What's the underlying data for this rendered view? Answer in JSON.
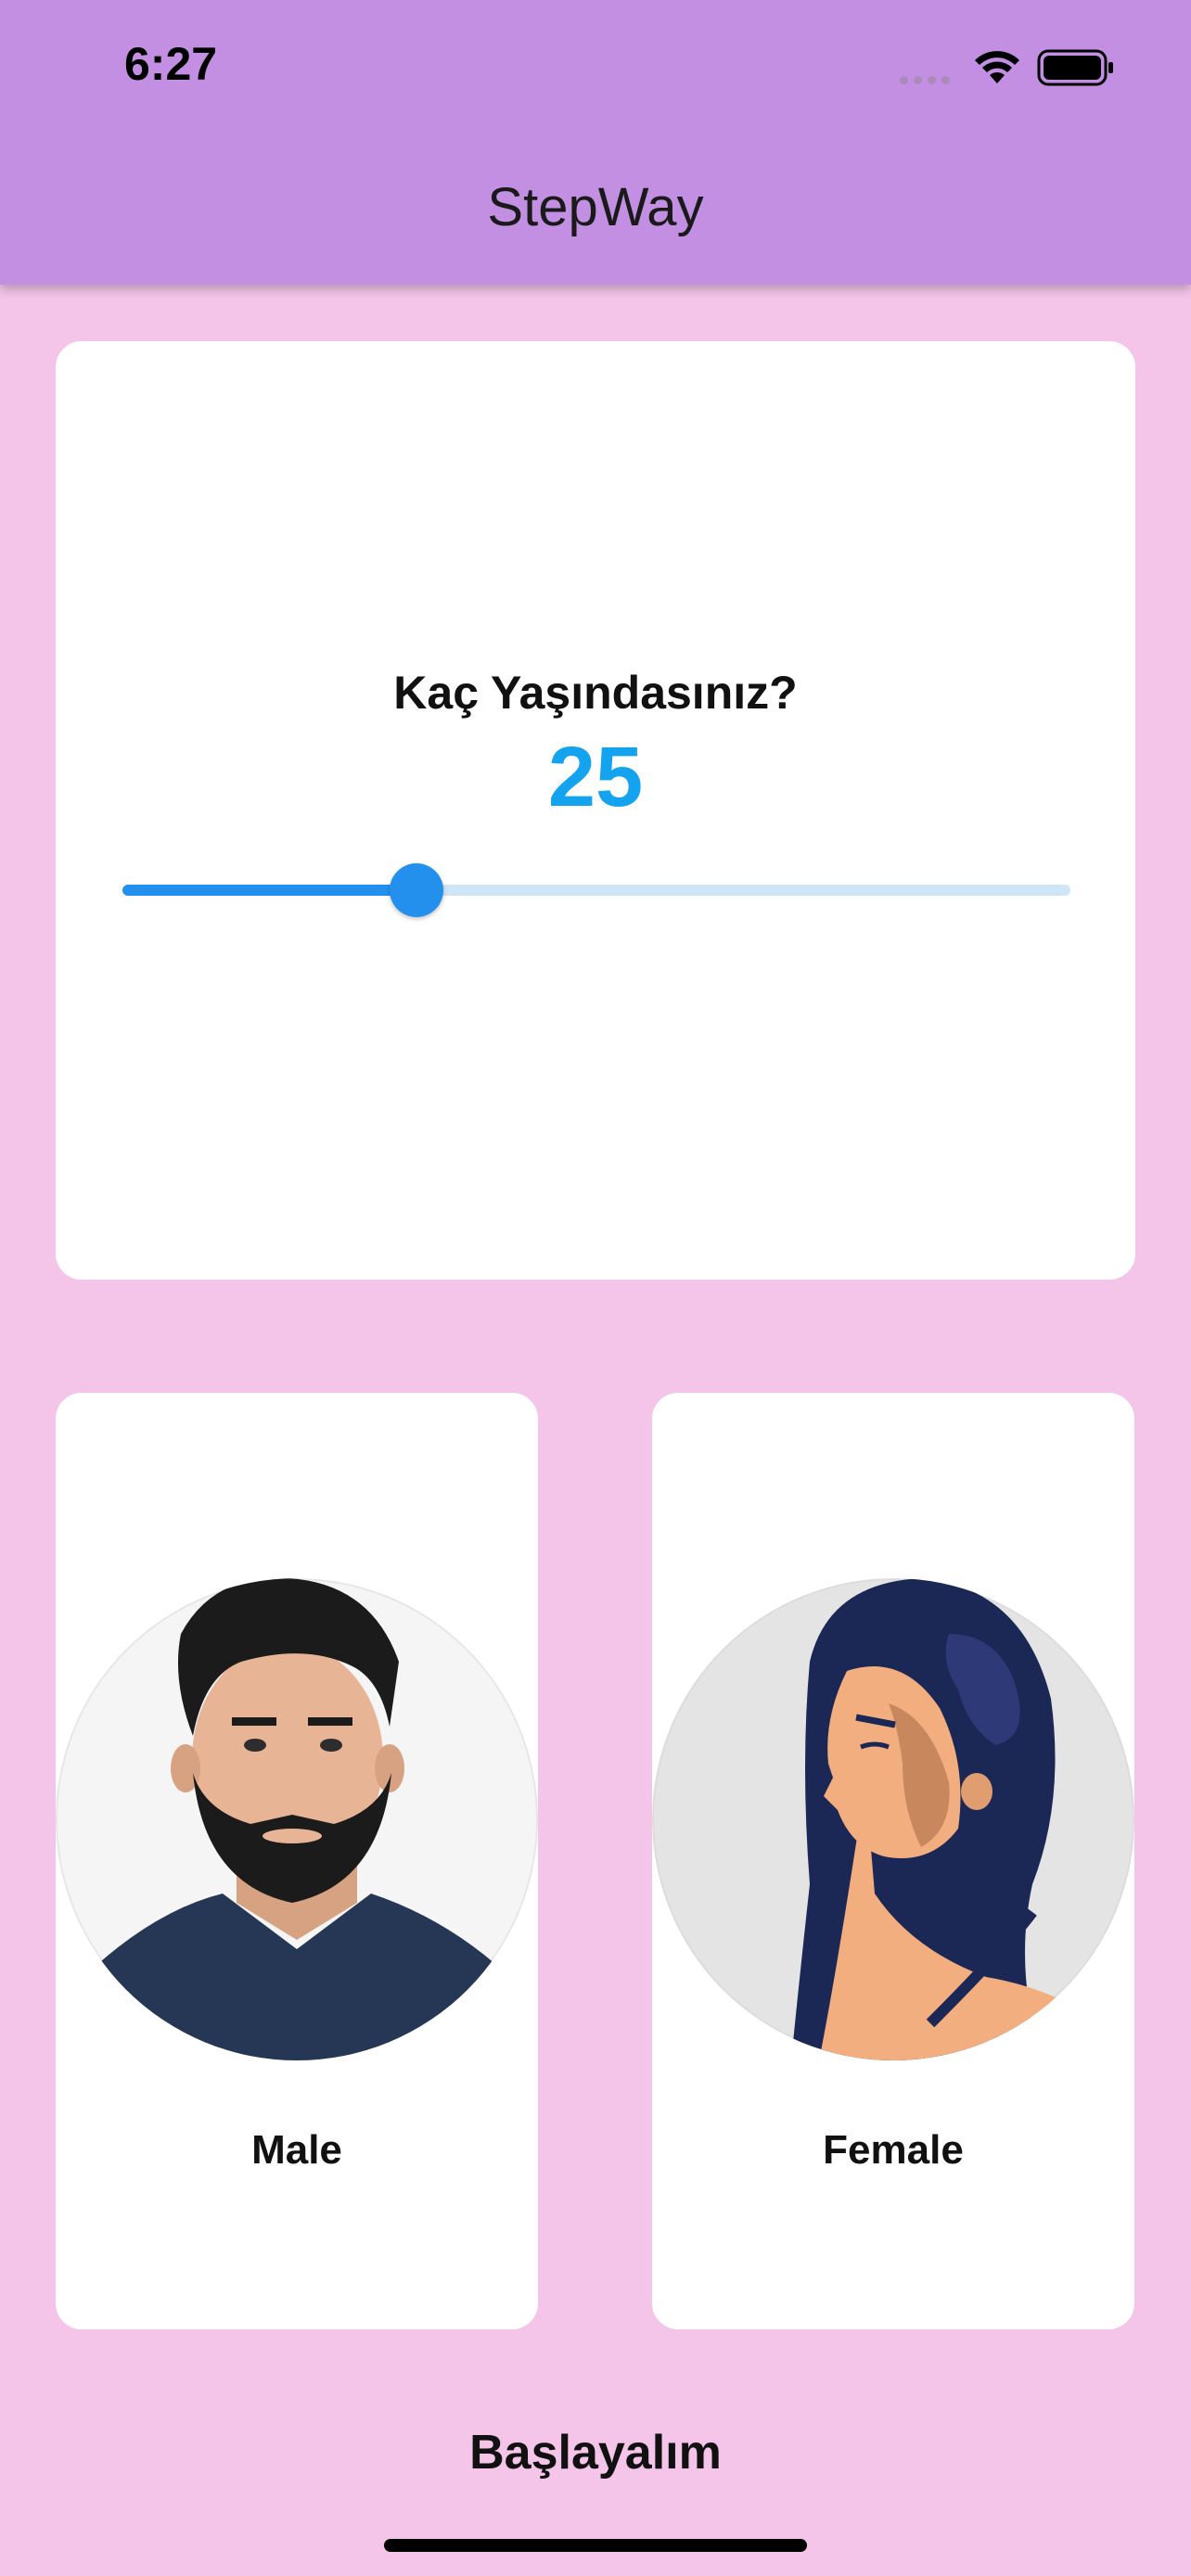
{
  "status_bar": {
    "time": "6:27"
  },
  "app": {
    "title": "StepWay"
  },
  "age": {
    "question": "Kaç Yaşındasınız?",
    "value": "25",
    "slider_fraction": 0.31
  },
  "gender": {
    "male": {
      "label": "Male",
      "icon": "male-avatar"
    },
    "female": {
      "label": "Female",
      "icon": "female-avatar"
    }
  },
  "actions": {
    "start_label": "Başlayalım"
  },
  "colors": {
    "app_bar": "#c28fe3",
    "background": "#f4c5e9",
    "accent": "#2490ee",
    "age_value": "#14a3ee"
  }
}
